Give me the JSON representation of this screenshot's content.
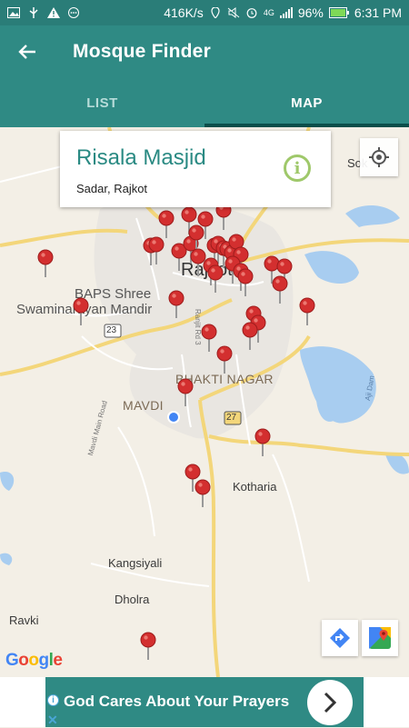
{
  "status_bar": {
    "network_speed": "416K/s",
    "network_type": "4G",
    "battery": "96%",
    "time": "6:31 PM",
    "icons": [
      "image-icon",
      "usb-icon",
      "warning-icon",
      "message-icon",
      "location-icon",
      "mute-icon",
      "alarm-icon",
      "signal-icon",
      "battery-icon"
    ]
  },
  "app_bar": {
    "title": "Mosque Finder",
    "back_icon": "arrow-back-icon"
  },
  "tabs": [
    {
      "label": "LIST",
      "active": false
    },
    {
      "label": "MAP",
      "active": true
    }
  ],
  "info_card": {
    "name": "Risala Masjid",
    "address": "Sadar, Rajkot",
    "info_icon": "info-icon"
  },
  "map": {
    "labels": {
      "city": "Rajkot",
      "baps1": "BAPS Shree",
      "baps2": "Swaminarayan Mandir",
      "bhakti": "BHAKTI NAGAR",
      "mavdi": "MAVDI",
      "kotharia": "Kotharia",
      "kangsiyali": "Kangsiyali",
      "dholra": "Dholra",
      "ravki": "Ravki",
      "sok": "Sok",
      "highway23": "23",
      "highway27": "27",
      "mavdi_road": "Mavdi Main Road",
      "ranjit": "Ranjit Rd 3",
      "aji_dam": "Aji Dam"
    },
    "attribution": {
      "g": "G",
      "o1": "o",
      "o2": "o",
      "g2": "g",
      "l": "l",
      "e": "e"
    },
    "location_button_icon": "my-location-icon",
    "directions_icon": "directions-icon",
    "google_maps_icon": "google-maps-icon"
  },
  "ad": {
    "text": "God Cares About Your Prayers",
    "arrow_icon": "chevron-right-icon",
    "info_icon": "ad-info-icon",
    "close_label": "✕"
  },
  "colors": {
    "primary": "#2f8a84",
    "pin": "#d32f2f",
    "water": "#a8cdf0",
    "accent": "#9fc86a"
  }
}
